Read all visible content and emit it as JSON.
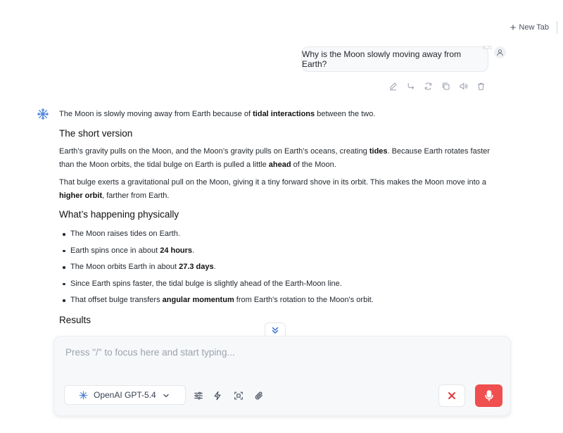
{
  "header": {
    "new_tab_label": "New Tab"
  },
  "user_message": {
    "text": "Why is the Moon slowly moving away from Earth?",
    "timestamp": "3:21"
  },
  "message_actions": [
    "edit-icon",
    "branch-icon",
    "regenerate-icon",
    "copy-icon",
    "read-aloud-icon",
    "delete-icon"
  ],
  "assistant": {
    "intro": {
      "pre": "The Moon is slowly moving away from Earth because of ",
      "bold": "tidal interactions",
      "post": " between the two."
    },
    "h1": "The short version",
    "p1": {
      "a": "Earth’s gravity pulls on the Moon, and the Moon’s gravity pulls on Earth’s oceans, creating ",
      "b": "tides",
      "c": ". Because Earth rotates faster than the Moon orbits, the tidal bulge on Earth is pulled a little ",
      "d": "ahead",
      "e": " of the Moon."
    },
    "p2": {
      "a": "That bulge exerts a gravitational pull on the Moon, giving it a tiny forward shove in its orbit. This makes the Moon move into a ",
      "b": "higher orbit",
      "c": ", farther from Earth."
    },
    "h2": "What’s happening physically",
    "bullets": [
      {
        "pre": "The Moon raises tides on Earth.",
        "bold": "",
        "post": ""
      },
      {
        "pre": "Earth spins once in about ",
        "bold": "24 hours",
        "post": "."
      },
      {
        "pre": "The Moon orbits Earth in about ",
        "bold": "27.3 days",
        "post": "."
      },
      {
        "pre": "Since Earth spins faster, the tidal bulge is slightly ahead of the Earth-Moon line.",
        "bold": "",
        "post": ""
      },
      {
        "pre": "That offset bulge transfers ",
        "bold": "angular momentum",
        "post": " from Earth's rotation to the Moon's orbit."
      }
    ],
    "h3": "Results"
  },
  "composer": {
    "placeholder": "Press \"/\" to focus here and start typing...",
    "model": "OpenAI GPT-5.4",
    "tools": [
      "settings-sliders-icon",
      "lightning-icon",
      "screenshot-icon",
      "attachment-icon"
    ]
  },
  "colors": {
    "accent": "#ef4f4f",
    "ai_icon": "#4a7fd9"
  }
}
